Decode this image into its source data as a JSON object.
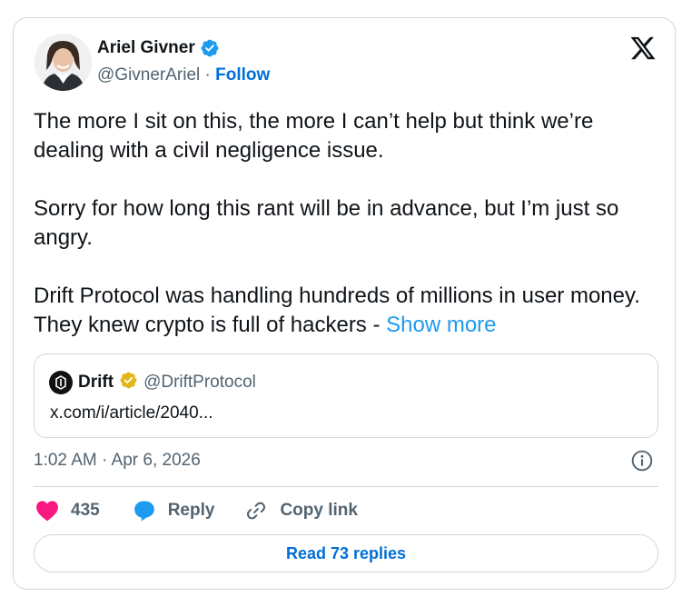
{
  "author": {
    "name": "Ariel Givner",
    "handle": "@GivnerAriel",
    "separator": "·",
    "follow_label": "Follow"
  },
  "tweet": {
    "paragraphs": [
      "The more I sit on this, the more I can’t help but think we’re dealing with a civil negligence issue.",
      "Sorry for how long this rant will be in advance, but I’m just so angry.",
      "Drift Protocol was handling hundreds of millions in user money. They knew crypto is full of hackers -"
    ],
    "show_more_label": "Show more"
  },
  "quote": {
    "name": "Drift",
    "handle": "@DriftProtocol",
    "link_text": "x.com/i/article/2040..."
  },
  "timestamp": "1:02 AM · Apr 6, 2026",
  "actions": {
    "like_count": "435",
    "reply_label": "Reply",
    "copy_link_label": "Copy link"
  },
  "read_replies_label": "Read 73 replies",
  "colors": {
    "accent": "#1d9bf0",
    "link": "#006fd6",
    "like": "#f91880",
    "muted": "#536471",
    "gold_badge": "#e2b719"
  },
  "icons": {
    "logo": "x-logo-icon",
    "verified": "verified-badge-icon",
    "quote_verified": "gold-verified-badge-icon",
    "info": "info-icon",
    "like": "heart-icon",
    "reply": "reply-bubble-icon",
    "copy_link": "link-icon"
  }
}
